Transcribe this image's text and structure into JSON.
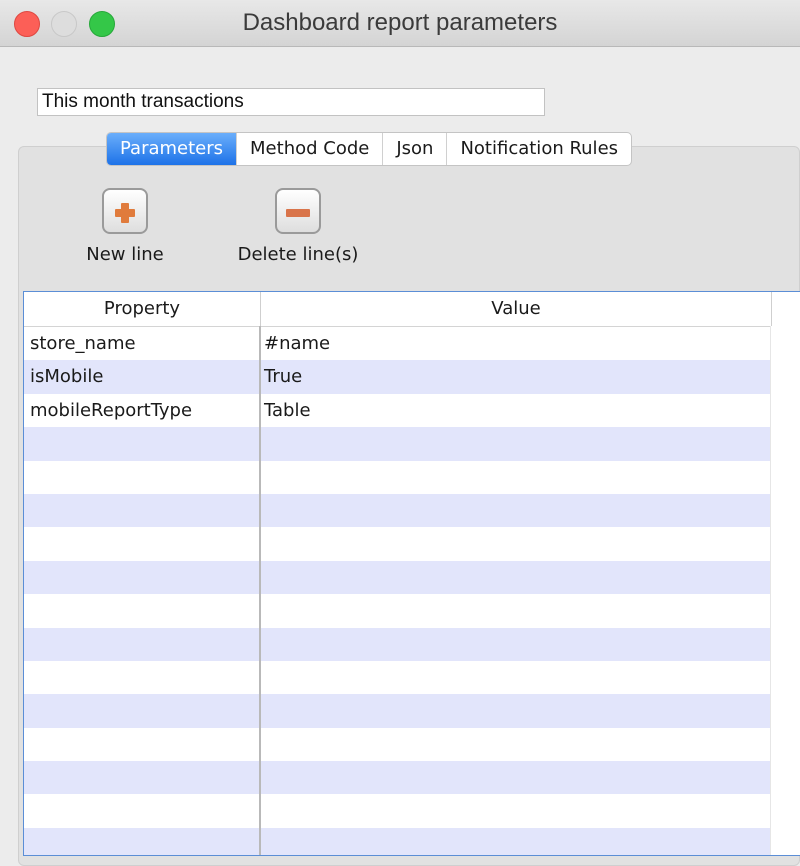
{
  "window": {
    "title": "Dashboard report parameters"
  },
  "name_field": {
    "value": "This month transactions"
  },
  "tabs": [
    {
      "label": "Parameters",
      "active": true
    },
    {
      "label": "Method Code",
      "active": false
    },
    {
      "label": "Json",
      "active": false
    },
    {
      "label": "Notification Rules",
      "active": false
    }
  ],
  "toolbar": {
    "new_line": {
      "label": "New line",
      "icon": "plus-icon"
    },
    "delete_lines": {
      "label": "Delete line(s)",
      "icon": "minus-icon"
    }
  },
  "table": {
    "headers": {
      "property": "Property",
      "value": "Value"
    },
    "rows": [
      {
        "property": "store_name",
        "value": "#name"
      },
      {
        "property": "isMobile",
        "value": "True"
      },
      {
        "property": "mobileReportType",
        "value": "Table"
      },
      {
        "property": "",
        "value": ""
      },
      {
        "property": "",
        "value": ""
      },
      {
        "property": "",
        "value": ""
      },
      {
        "property": "",
        "value": ""
      },
      {
        "property": "",
        "value": ""
      },
      {
        "property": "",
        "value": ""
      },
      {
        "property": "",
        "value": ""
      },
      {
        "property": "",
        "value": ""
      },
      {
        "property": "",
        "value": ""
      },
      {
        "property": "",
        "value": ""
      },
      {
        "property": "",
        "value": ""
      },
      {
        "property": "",
        "value": ""
      },
      {
        "property": "",
        "value": ""
      }
    ]
  },
  "colors": {
    "active_tab": "#1d72e8",
    "row_alt": "#e2e5fb",
    "close_button": "#fc5f57",
    "zoom_button": "#34c748",
    "icon_orange": "#e07b3c"
  }
}
